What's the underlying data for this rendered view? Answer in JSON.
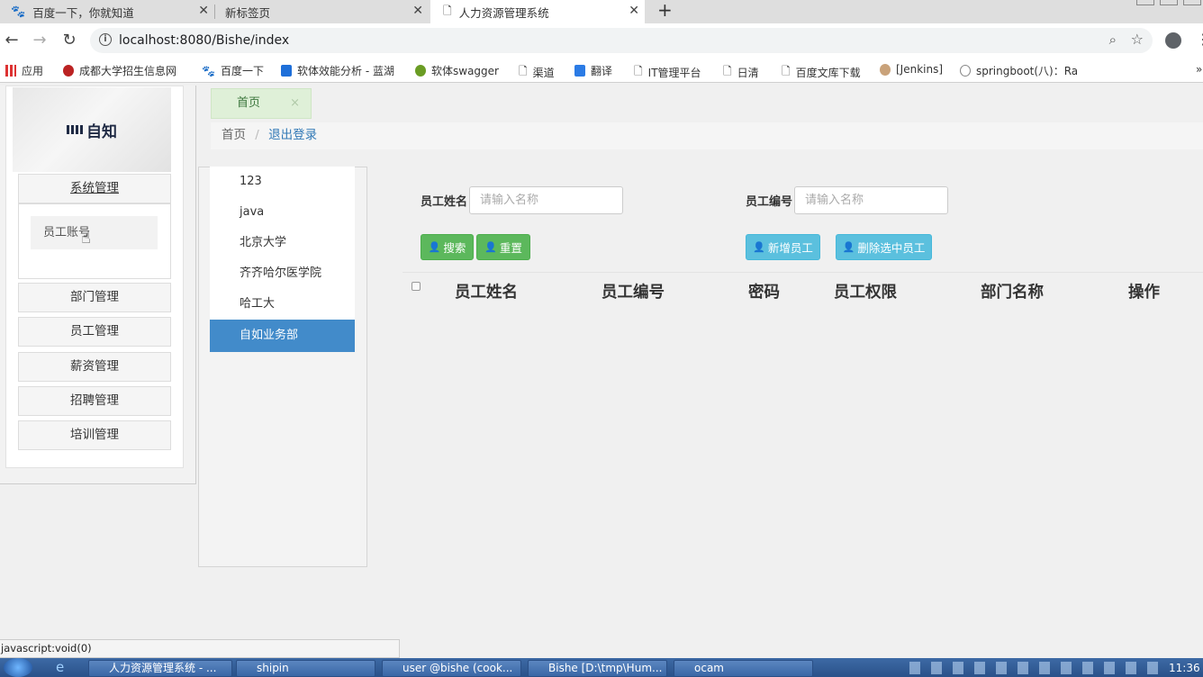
{
  "browser": {
    "tabs": [
      {
        "title": "百度一下，你就知道"
      },
      {
        "title": "新标签页"
      },
      {
        "title": "人力资源管理系统"
      }
    ],
    "url": "localhost:8080/Bishe/index",
    "bookmarks": [
      {
        "label": "应用"
      },
      {
        "label": "成都大学招生信息网"
      },
      {
        "label": "百度一下"
      },
      {
        "label": "软体效能分析 - 蓝湖"
      },
      {
        "label": "软体swagger"
      },
      {
        "label": "渠道"
      },
      {
        "label": "翻译"
      },
      {
        "label": "IT管理平台"
      },
      {
        "label": "日清"
      },
      {
        "label": "百度文库下载"
      },
      {
        "label": "[Jenkins]"
      },
      {
        "label": "springboot(八)：Ra"
      }
    ],
    "more": "»"
  },
  "sidebar": {
    "logo_text": "自知",
    "menus": [
      {
        "label": "系统管理"
      },
      {
        "label": "部门管理"
      },
      {
        "label": "员工管理"
      },
      {
        "label": "薪资管理"
      },
      {
        "label": "招聘管理"
      },
      {
        "label": "培训管理"
      }
    ],
    "submenu": {
      "label": "员工账号"
    }
  },
  "pagetab": {
    "label": "首页",
    "close": "×"
  },
  "breadcrumb": {
    "home": "首页",
    "sep": "/",
    "logout": "退出登录"
  },
  "departments": [
    {
      "label": "123"
    },
    {
      "label": "java"
    },
    {
      "label": "北京大学"
    },
    {
      "label": "齐齐哈尔医学院"
    },
    {
      "label": "哈工大"
    },
    {
      "label": "自如业务部",
      "active": true
    }
  ],
  "filters": {
    "name_label": "员工姓名",
    "name_placeholder": "请输入名称",
    "id_label": "员工编号",
    "id_placeholder": "请输入名称"
  },
  "buttons": {
    "search": "搜索",
    "reset": "重置",
    "add": "新增员工",
    "delete": "删除选中员工"
  },
  "table": {
    "headers": [
      "员工姓名",
      "员工编号",
      "密码",
      "员工权限",
      "部门名称",
      "操作"
    ]
  },
  "status": "javascript:void(0)",
  "taskbar": {
    "items": [
      {
        "label": "人力资源管理系统 - ..."
      },
      {
        "label": "shipin"
      },
      {
        "label": "user @bishe (cook..."
      },
      {
        "label": "Bishe [D:\\tmp\\Hum..."
      },
      {
        "label": "ocam"
      }
    ],
    "clock": "11:36"
  },
  "colors": {
    "primary": "#428bca",
    "success": "#5cb85c",
    "info": "#5bc0de",
    "tab_active_bg": "#dff0d8"
  }
}
